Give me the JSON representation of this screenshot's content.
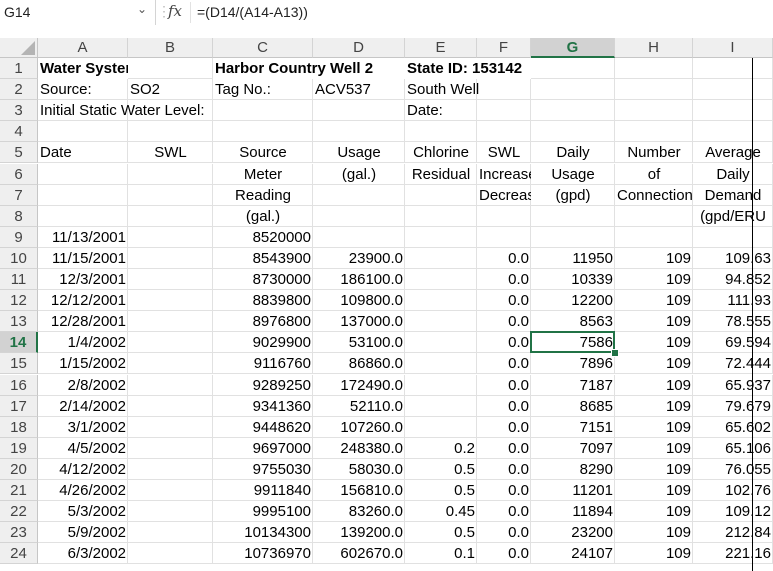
{
  "formula_bar": {
    "name_box": "G14",
    "formula": "=(D14/(A14-A13))",
    "fx_label": "fx"
  },
  "columns": [
    "A",
    "B",
    "C",
    "D",
    "E",
    "F",
    "G",
    "H",
    "I"
  ],
  "rows": [
    "1",
    "2",
    "3",
    "4",
    "5",
    "6",
    "7",
    "8",
    "9",
    "10",
    "11",
    "12",
    "13",
    "14",
    "15",
    "16",
    "17",
    "18",
    "19",
    "20",
    "21",
    "22",
    "23",
    "24"
  ],
  "selected": {
    "column": "G",
    "row": "14"
  },
  "header": {
    "r1": {
      "a": "Water System Name",
      "c": "Harbor Country Well 2",
      "e": "State ID: 153142"
    },
    "r2": {
      "a": "Source:",
      "b": "SO2",
      "c": "Tag No.:",
      "d": "ACV537",
      "e": "South Well"
    },
    "r3": {
      "a": "Initial Static Water Level:",
      "e": "Date:"
    },
    "r5": {
      "a": "Date",
      "b": "SWL",
      "c": "Source",
      "d": "Usage",
      "e": "Chlorine",
      "f": "SWL",
      "g": "Daily",
      "h": "Number",
      "i": "Average"
    },
    "r6": {
      "c": "Meter",
      "d": "(gal.)",
      "e": "Residual",
      "f": "Increase",
      "g": "Usage",
      "h": "of",
      "i": "Daily"
    },
    "r7": {
      "c": "Reading",
      "f": "Decrease",
      "g": "(gpd)",
      "h": "Connections",
      "i": "Demand"
    },
    "r8": {
      "c": "(gal.)",
      "i": "(gpd/ERU"
    }
  },
  "data_rows": [
    {
      "date": "11/13/2001",
      "meter": "8520000",
      "usage": "",
      "chlorine": "",
      "swl": "",
      "daily": "",
      "conn": "",
      "avg": ""
    },
    {
      "date": "11/15/2001",
      "meter": "8543900",
      "usage": "23900.0",
      "chlorine": "",
      "swl": "0.0",
      "daily": "11950",
      "conn": "109",
      "avg": "109.63"
    },
    {
      "date": "12/3/2001",
      "meter": "8730000",
      "usage": "186100.0",
      "chlorine": "",
      "swl": "0.0",
      "daily": "10339",
      "conn": "109",
      "avg": "94.852"
    },
    {
      "date": "12/12/2001",
      "meter": "8839800",
      "usage": "109800.0",
      "chlorine": "",
      "swl": "0.0",
      "daily": "12200",
      "conn": "109",
      "avg": "111.93"
    },
    {
      "date": "12/28/2001",
      "meter": "8976800",
      "usage": "137000.0",
      "chlorine": "",
      "swl": "0.0",
      "daily": "8563",
      "conn": "109",
      "avg": "78.555"
    },
    {
      "date": "1/4/2002",
      "meter": "9029900",
      "usage": "53100.0",
      "chlorine": "",
      "swl": "0.0",
      "daily": "7586",
      "conn": "109",
      "avg": "69.594"
    },
    {
      "date": "1/15/2002",
      "meter": "9116760",
      "usage": "86860.0",
      "chlorine": "",
      "swl": "0.0",
      "daily": "7896",
      "conn": "109",
      "avg": "72.444"
    },
    {
      "date": "2/8/2002",
      "meter": "9289250",
      "usage": "172490.0",
      "chlorine": "",
      "swl": "0.0",
      "daily": "7187",
      "conn": "109",
      "avg": "65.937"
    },
    {
      "date": "2/14/2002",
      "meter": "9341360",
      "usage": "52110.0",
      "chlorine": "",
      "swl": "0.0",
      "daily": "8685",
      "conn": "109",
      "avg": "79.679"
    },
    {
      "date": "3/1/2002",
      "meter": "9448620",
      "usage": "107260.0",
      "chlorine": "",
      "swl": "0.0",
      "daily": "7151",
      "conn": "109",
      "avg": "65.602"
    },
    {
      "date": "4/5/2002",
      "meter": "9697000",
      "usage": "248380.0",
      "chlorine": "0.2",
      "swl": "0.0",
      "daily": "7097",
      "conn": "109",
      "avg": "65.106"
    },
    {
      "date": "4/12/2002",
      "meter": "9755030",
      "usage": "58030.0",
      "chlorine": "0.5",
      "swl": "0.0",
      "daily": "8290",
      "conn": "109",
      "avg": "76.055"
    },
    {
      "date": "4/26/2002",
      "meter": "9911840",
      "usage": "156810.0",
      "chlorine": "0.5",
      "swl": "0.0",
      "daily": "11201",
      "conn": "109",
      "avg": "102.76"
    },
    {
      "date": "5/3/2002",
      "meter": "9995100",
      "usage": "83260.0",
      "chlorine": "0.45",
      "swl": "0.0",
      "daily": "11894",
      "conn": "109",
      "avg": "109.12"
    },
    {
      "date": "5/9/2002",
      "meter": "10134300",
      "usage": "139200.0",
      "chlorine": "0.5",
      "swl": "0.0",
      "daily": "23200",
      "conn": "109",
      "avg": "212.84"
    },
    {
      "date": "6/3/2002",
      "meter": "10736970",
      "usage": "602670.0",
      "chlorine": "0.1",
      "swl": "0.0",
      "daily": "24107",
      "conn": "109",
      "avg": "221.16"
    }
  ]
}
